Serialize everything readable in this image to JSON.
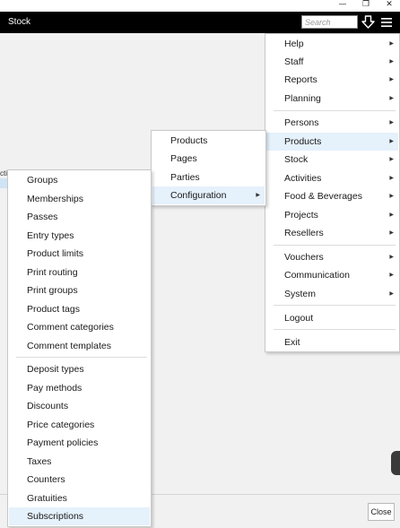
{
  "window": {
    "minimize": "—",
    "restore": "❐",
    "close": "✕"
  },
  "app": {
    "title": "Stock"
  },
  "search": {
    "placeholder": "Search"
  },
  "table": {
    "column_fragment": "cti"
  },
  "footer": {
    "close_label": "Close"
  },
  "main_menu": {
    "items": [
      {
        "label": "Help",
        "submenu": true
      },
      {
        "label": "Staff",
        "submenu": true
      },
      {
        "label": "Reports",
        "submenu": true
      },
      {
        "label": "Planning",
        "submenu": true
      },
      {
        "label": "Persons",
        "submenu": true
      },
      {
        "label": "Products",
        "submenu": true,
        "highlighted": true
      },
      {
        "label": "Stock",
        "submenu": true
      },
      {
        "label": "Activities",
        "submenu": true
      },
      {
        "label": "Food & Beverages",
        "submenu": true
      },
      {
        "label": "Projects",
        "submenu": true
      },
      {
        "label": "Resellers",
        "submenu": true
      },
      {
        "label": "Vouchers",
        "submenu": true
      },
      {
        "label": "Communication",
        "submenu": true
      },
      {
        "label": "System",
        "submenu": true
      },
      {
        "label": "Logout",
        "submenu": false
      },
      {
        "label": "Exit",
        "submenu": false
      }
    ]
  },
  "products_menu": {
    "items": [
      {
        "label": "Products",
        "submenu": false
      },
      {
        "label": "Pages",
        "submenu": false
      },
      {
        "label": "Parties",
        "submenu": false
      },
      {
        "label": "Configuration",
        "submenu": true,
        "highlighted": true
      }
    ]
  },
  "config_menu": {
    "items": [
      {
        "label": "Groups"
      },
      {
        "label": "Memberships"
      },
      {
        "label": "Passes"
      },
      {
        "label": "Entry types"
      },
      {
        "label": "Product limits"
      },
      {
        "label": "Print routing"
      },
      {
        "label": "Print groups"
      },
      {
        "label": "Product tags"
      },
      {
        "label": "Comment categories"
      },
      {
        "label": "Comment templates"
      },
      {
        "label": "Deposit types"
      },
      {
        "label": "Pay methods"
      },
      {
        "label": "Discounts"
      },
      {
        "label": "Price categories"
      },
      {
        "label": "Payment policies"
      },
      {
        "label": "Taxes"
      },
      {
        "label": "Counters"
      },
      {
        "label": "Gratuities"
      },
      {
        "label": "Subscriptions",
        "highlighted": true
      }
    ]
  }
}
